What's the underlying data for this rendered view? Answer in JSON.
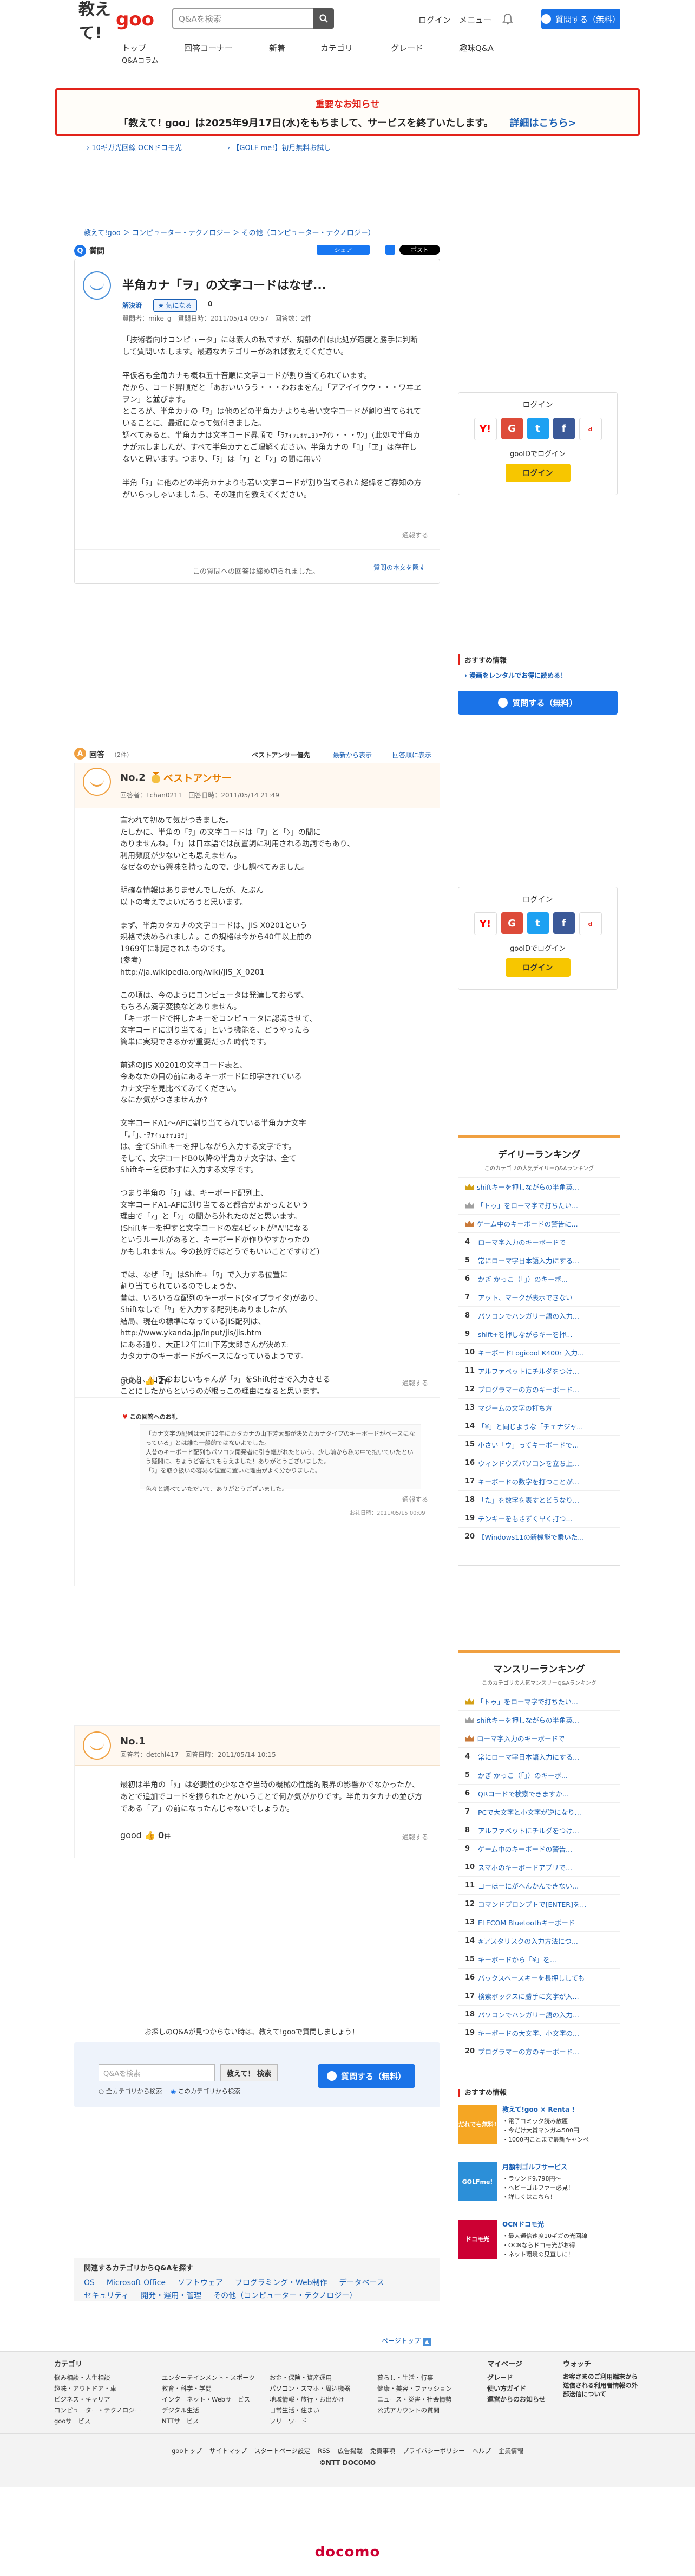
{
  "header": {
    "logo_text": "教えて!",
    "logo_goo": "goo",
    "search_placeholder": "Q&Aを検索",
    "login": "ログイン",
    "menu": "メニュー",
    "ask_button": "質問する（無料）",
    "nav": [
      "トップ",
      "回答コーナー",
      "新着",
      "カテゴリ",
      "グレード",
      "趣味Q&A",
      "Q&Aコラム"
    ]
  },
  "notice": {
    "title": "重要なお知らせ",
    "body": "「教えて! goo」は2025年9月17日(水)をもちまして、サービスを終了いたします。",
    "link": "詳細はこちら>"
  },
  "promos": [
    "10ギガ光回線 OCNドコモ光",
    "【GOLF me!】初月無料お試し"
  ],
  "breadcrumb": "教えて!goo ＞ コンピューター・テクノロジー ＞ その他（コンピューター・テクノロジー）",
  "question": {
    "section_label": "質問",
    "title": "半角カナ「ヲ」の文字コードはなぜ...",
    "share_fb": "シェア",
    "share_x": "ポスト",
    "solved": "解決済",
    "same_label": "気になる",
    "same_count": "0",
    "meta": "質問者：mike_g　質問日時：2011/05/14 09:57　回答数：2件",
    "body": "「技術者向けコンピュータ」には素人の私ですが、規部の件は此処が適度と勝手に判断して質問いたします。最適なカテゴリーがあれば教えてください。\n\n平仮名も全角カナも概ね五十音順に文字コードが割り当てられています。\nだから、コード昇順だと「あおいいうう・・・わおまをん」「アアイイウウ・・・ワヰヱヲン」と並びます。\nところが、半角カナの「ｦ」は他のどの半角カナよりも若い文字コードが割り当てられていることに、最近になって気付きました。\n調べてみると、半角カナは文字コード昇順で「ｦｧｨｩｪｫｬｭｮｯｰｱｲｳ・・・ﾜﾝ」(此処で半角カナが示しましたが、すべて半角カナとご理解ください。半角カナの「ﾛ」「ヱ」は存在しないと思います。つまり、「ｦ」は「ｧ」と「ﾝ」の間に無い）\n\n半角「ｦ」に他のどの半角カナよりも若い文字コードが割り当てられた経緯をご存知の方がいらっしゃいましたら、その理由を教えてください。",
    "report": "通報する",
    "closed": "この質問への回答は締め切られました。",
    "show_hint": "質問の本文を隠す"
  },
  "login_widget": {
    "title": "ログイン",
    "goo_login": "gooIDでログイン",
    "login_button": "ログイン"
  },
  "osusume": {
    "title": "おすすめ情報",
    "link": "漫画をレンタルでお得に読める！",
    "ask_button": "質問する（無料）"
  },
  "answers": {
    "section_label": "回答",
    "count": "（2件）",
    "sort": [
      "ベストアンサー優先",
      "最新から表示",
      "回答順に表示"
    ],
    "items": [
      {
        "no": "No.2",
        "best": "ベストアンサー",
        "meta": "回答者：Lchan0211　回答日時：2011/05/14 21:49",
        "body": "言われて初めて気がつきました。\nたしかに、半角の「ｦ」の文字コードは「ｱ」と「ﾝ」の間に\nありませんね。「ｦ」は日本語では前置詞に利用される助詞でもあり、\n利用頻度が少ないとも思えません。\nなぜなのかも興味を持ったので、少し調べてみました。\n\n明確な情報はありませんでしたが、たぶん\n以下の考えでよいだろうと思います。\n\nまず、半角カタカナの文字コードは、JIS X0201という\n規格で決められました。この規格は今から40年以上前の\n1969年に制定されたものです。\n(参考)\nhttp://ja.wikipedia.org/wiki/JIS_X_0201\n\nこの頃は、今のようにコンピュータは発達しておらず、\nもちろん漢字変換などありません。\n「キーボードで押したキーをコンピュータに認識させて、\n文字コードに割り当てる」という機能を、どうやったら\n簡単に実現できるかが重要だった時代です。\n\n前述のJIS X0201の文字コード表と、\n今あなたの目の前にあるキーボードに印字されている\nカナ文字を見比べてみてください。\nなにか気がつきませんか?\n\n文字コードA1～AFに割り当てられている半角カナ文字\n「｡｢｣､･ｦｧｨｩｪｫｬｭｮｯ」\nは、全てShiftキーを押しながら入力する文字です。\nそして、文字コードB0以降の半角カナ文字は、全て\nShiftキーを使わずに入力する文字です。\n\nつまり半角の「ｦ」は、キーボード配列上、\n文字コードA1-AFに割り当てると都合がよかったという\n理由で「ｧ」と「ﾝ」の間から外れたのだと思います。\n(Shiftキーを押すと文字コードの左4ビットが\"A\"になる\nというルールがあると、キーボードが作りやすかったの\nかもしれません。今の技術ではどうでもいいことですけど)\n\nでは、なぜ「ｦ」はShift+「ﾜ」で入力する位置に\n割り当てられているのでしょうか。\n昔は、いろいろな配列のキーボード(タイプライタ)があり、\nShiftなしで「ﾔ」を入力する配列もありましたが、\n結局、現在の標準になっているJIS配列は、\nhttp://www.ykanda.jp/input/jis/jis.htm\nにある通り、大正12年に山下芳太郎さんが決めた\nカタカナのキーボードがベースになっているようです。\n\nつまり、山下のおじいちゃんが「ｦ」をShift付きで入力させる\nことにしたからというのが根っこの理由になると思います。",
        "good_label": "good",
        "good_count": "2",
        "good_unit": "件",
        "report": "通報する",
        "thanks_title": "この回答へのお礼",
        "thanks": "「カナ文字の配列は大正12年にカタカナの山下芳太郎が決めたカナタイプのキーボードがベースになっている」とは誰も一般的ではないよでした。\n大昔のキーボード配列もパソコン開発者に引き継がれたという、少し前から私の中で抱いていたという疑問に、ちょうど答えてもらえました！ありがとうございました。\n「ｦ」を取り扱いの容易な位置に置いた理由がよく分かりました。\n\n色々と調べていただいて、ありがとうございました。",
        "thanks_date": "お礼日時：2011/05/15 00:09"
      },
      {
        "no": "No.1",
        "meta": "回答者：detchi417　回答日時：2011/05/14 10:15",
        "body": "最初は半角の「ｦ」は必要性の少なさや当時の機械の性能的限界の影響かでなかったか、あとで追加でコードを振られたとかいうことで何か気がかりです。半角カタカナの並び方である「ア」の前になったんじゃないでしょうか。",
        "good_label": "good",
        "good_count": "0",
        "good_unit": "件",
        "report": "通報する"
      }
    ]
  },
  "daily_ranking": {
    "title": "デイリーランキング",
    "subtitle": "このカテゴリの人気デイリーQ&Aランキング",
    "items": [
      "shiftキーを押しながらの半角英...",
      "「トゥ」をローマ字で打ちたい...",
      "ゲーム中のキーボードの警告に...",
      "ローマ字入力のキーボードで",
      "常にローマ字日本語入力にする...",
      "かぎ かっこ（「」）のキーボ...",
      "アット、マークが表示できない",
      "パソコンでハンガリー語の入力...",
      "shift+を押しながらキーを押...",
      "キーボードLogicool K400r 入力...",
      "アルファベットにチルダをつけ...",
      "プログラマーの方のキーボード...",
      "マジームの文字の打ち方",
      "「¥」と同じような「チェナジャ...",
      "小さい「ウ」ってキーボードで...",
      "ウィンドウズパソコンを立ち上...",
      "キーボードの数字を打つことが...",
      "「た」を数字を表すとどうなり...",
      "テンキーをもさずく早く打つ...",
      "【Windows11の新機能で乗いた..."
    ]
  },
  "monthly_ranking": {
    "title": "マンスリーランキング",
    "subtitle": "このカテゴリの人気マンスリーQ&Aランキング",
    "items": [
      "「トゥ」をローマ字で打ちたい...",
      "shiftキーを押しながらの半角英...",
      "ローマ字入力のキーボードで",
      "常にローマ字日本語入力にする...",
      "かぎ かっこ（「」）のキーボ...",
      "QRコードで検索できますか...",
      "PCで大文字と小文字が逆になり...",
      "アルファベットにチルダをつけ...",
      "ゲーム中のキーボードの警告...",
      "スマホのキーボードアプリで...",
      "ヨーほーにがへんかんできない...",
      "コマンドプロンプトで[ENTER]を...",
      "ELECOM Bluetoothキーボード",
      "#アスタリスクの入力方法につ...",
      "キーボードから「¥」を...",
      "バックスペースキーを長押ししても",
      "検索ボックスに勝手に文字が入...",
      "パソコンでハンガリー語の入力...",
      "キーボードの大文字、小文字の...",
      "プログラマーの方のキーボード..."
    ]
  },
  "side_ads": [
    {
      "title": "教えて!goo × Renta !",
      "lines": [
        "・電子コミック読み放題",
        "・今だけ大賞マンガ本500円",
        "・1000円ことまで最新キャンペ"
      ],
      "badge": "だれでも無料!"
    },
    {
      "title": "月額制ゴルフサービス",
      "lines": [
        "・ラウンド9,798円〜",
        "・ヘビーゴルファー必見！",
        "・詳しくはこちら！"
      ],
      "badge": "GOLFme!"
    },
    {
      "title": "OCNドコモ光",
      "lines": [
        "・最大通信速度10ギガの光回線",
        "・OCNならドコモ光がお得",
        "・ネット環境の見直しに！"
      ],
      "badge": "ドコモ光"
    }
  ],
  "bottom_search": {
    "prompt": "お探しのQ&Aが見つからない時は、教えて!gooで質問しましょう！",
    "placeholder": "Q&Aを検索",
    "search_button": "教えて！ 検索",
    "radio_all": "全カテゴリから検索",
    "radio_this": "このカテゴリから検索",
    "ask_button": "質問する（無料）"
  },
  "related": {
    "title": "関連するカテゴリからQ&Aを探す",
    "items": [
      "OS",
      "Microsoft Office",
      "ソフトウェア",
      "プログラミング・Web制作",
      "データベース",
      "セキュリティ",
      "開発・運用・管理",
      "その他（コンピューター・テクノロジー）"
    ]
  },
  "page_top": "ページトップ",
  "footer": {
    "category_title": "カテゴリ",
    "cols": [
      [
        "悩み相談・人生相談",
        "趣味・アウトドア・車",
        "ビジネス・キャリア",
        "コンピューター・テクノロジー",
        "gooサービス"
      ],
      [
        "エンターテインメント・スポーツ",
        "教育・科学・学問",
        "インターネット・Webサービス",
        "デジタル生活",
        "NTTサービス"
      ],
      [
        "お金・保険・資産運用",
        "パソコン・スマホ・周辺機器",
        "地域情報・旅行・お出かけ",
        "日常生活・住まい",
        "フリーワード"
      ],
      [
        "暮らし・生活・行事",
        "健康・美容・ファッション",
        "ニュース・災害・社会情勢",
        "公式アカウントの質問"
      ]
    ],
    "mypage_title": "マイページ",
    "mypage": [
      "グレード",
      "使い方ガイド",
      "運営からのお知らせ"
    ],
    "watch_title": "ウォッチ",
    "watch": "お客さまのご利用端末から送信される利用者情報の外部送信について",
    "bottom_links": [
      "gooトップ",
      "サイトマップ",
      "スタートページ設定",
      "RSS",
      "広告掲載",
      "免責事項",
      "プライバシーポリシー",
      "ヘルプ",
      "企業情報"
    ],
    "copyright": "©NTT DOCOMO",
    "docomo": "docomo"
  },
  "colors": {
    "brand_red": "#e2231a",
    "accent_blue": "#1a73e8",
    "answer_orange": "#f0a040"
  }
}
